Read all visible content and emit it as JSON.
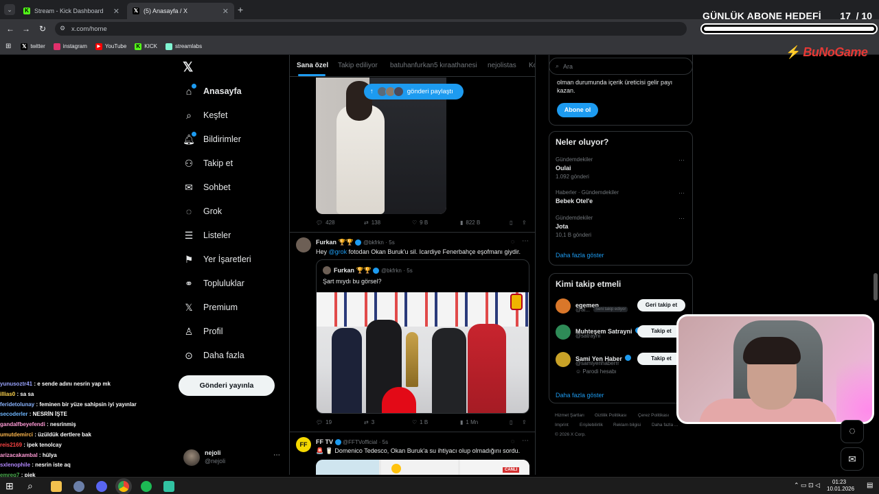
{
  "browser": {
    "tabs": [
      {
        "label": "Stream - Kick Dashboard",
        "active": false
      },
      {
        "label": "(5) Anasayfa / X",
        "active": true
      }
    ],
    "url": "x.com/home",
    "bookmarks": [
      "twitter",
      "instagram",
      "YouTube",
      "KICK",
      "streamlabs"
    ]
  },
  "goal": {
    "title": "GÜNLÜK ABONE HEDEFİ",
    "count": "17",
    "separator": "/ 10",
    "progress": 1.0
  },
  "watermark": "BuNoGame",
  "nav": {
    "items": [
      "Anasayfa",
      "Keşfet",
      "Bildirimler",
      "Takip et",
      "Sohbet",
      "Grok",
      "Listeler",
      "Yer İşaretleri",
      "Topluluklar",
      "Premium",
      "Profil",
      "Daha fazla"
    ],
    "post_button": "Gönderi yayınla",
    "account": {
      "name": "nejoli",
      "handle": "@nejoli"
    }
  },
  "feed": {
    "tabs": [
      "Sana özel",
      "Takip ediliyor",
      "batuhanfurkan5 kıraathanesi",
      "nejolistas",
      "Ko"
    ],
    "new_posts_pill": "gönderi paylaştı",
    "post1": {
      "replies": "428",
      "reposts": "138",
      "likes": "9 B",
      "views": "822 B"
    },
    "post2": {
      "name": "Furkan 🏆🏆",
      "handle": "@bkfrkn",
      "time": "· 5s",
      "text_pre": "Hey ",
      "mention": "@grok",
      "text_post": " fotodan Okan Buruk'u sil. Icardiye Fenerbahçe eşofmanı giydir.",
      "quote": {
        "name": "Furkan 🏆🏆",
        "handle": "@bkfrkn",
        "time": "· 5s",
        "text": "Şart mıydı bu görsel?"
      },
      "replies": "19",
      "reposts": "3",
      "likes": "1 B",
      "views": "1 Mn"
    },
    "post3": {
      "name": "FF TV",
      "handle": "@FFTVofficial",
      "time": "· 5s",
      "text": "🚨 🥛 Domenico Tedesco, Okan Buruk'a su ihtiyacı olup olmadığını sordu.",
      "image_label": "CANLI"
    }
  },
  "right": {
    "search_placeholder": "Ara",
    "premium": {
      "text": "olman durumunda içerik üreticisi gelir payı kazan.",
      "button": "Abone ol"
    },
    "trends_title": "Neler oluyor?",
    "trends": [
      {
        "category": "Gündemdekiler",
        "name": "Oulai",
        "count": "1.092 gönderi"
      },
      {
        "category": "Haberler · Gündemdekiler",
        "name": "Bebek Otel'e",
        "count": ""
      },
      {
        "category": "Gündemdekiler",
        "name": "Jota",
        "count": "10,1 B gönderi"
      }
    ],
    "show_more": "Daha fazla göster",
    "follow_title": "Kimi takip etmeli",
    "follow": [
      {
        "name": "egemen",
        "handle": "@al...",
        "badge": "Seni takip ediyor",
        "button": "Geri takip et"
      },
      {
        "name": "Muhteşem Satrayni",
        "handle": "@satrayni",
        "badge": "",
        "button": "Takip et"
      },
      {
        "name": "Sami Yen Haber",
        "handle": "@samiyenhaberrr",
        "badge": "Parodi hesabı",
        "button": "Takip et"
      }
    ],
    "follow_more": "Daha fazla göster",
    "footer": [
      "Hizmet Şartları",
      "Gizlilik Politikası",
      "Çerez Politikası",
      "Imprint",
      "Erişilebilirlik",
      "Reklam bilgisi",
      "Daha fazla ...",
      "© 2026 X Corp."
    ]
  },
  "chat": [
    {
      "user": "yunusoztr41",
      "color": "#9aa4ff",
      "msg": "e sende adını nesrin yap mk"
    },
    {
      "user": "illias0",
      "color": "#ffd54f",
      "msg": "sa sa"
    },
    {
      "user": "feridetolunay",
      "color": "#8ab4ff",
      "msg": "feminen bir yüze sahipsin iyi yayınlar"
    },
    {
      "user": "secoderler",
      "color": "#6fb7ff",
      "msg": "NESRİN İŞTE"
    },
    {
      "user": "gandalfbeyefendi",
      "color": "#ff9ad5",
      "msg": "nesrinmiş"
    },
    {
      "user": "umutdemirci",
      "color": "#ffb74d",
      "msg": "üzüldük dertlere bak"
    },
    {
      "user": "reis2169",
      "color": "#ff4444",
      "msg": "ipek tenolcay"
    },
    {
      "user": "arizacakambal",
      "color": "#ff9ad5",
      "msg": "hülya"
    },
    {
      "user": "sxlenophile",
      "color": "#b388ff",
      "msg": "nesrin iste aq"
    },
    {
      "user": "emreg7",
      "color": "#4caf50",
      "msg": "piek"
    }
  ],
  "clock": {
    "time": "01:23",
    "date": "10.01.2026"
  }
}
